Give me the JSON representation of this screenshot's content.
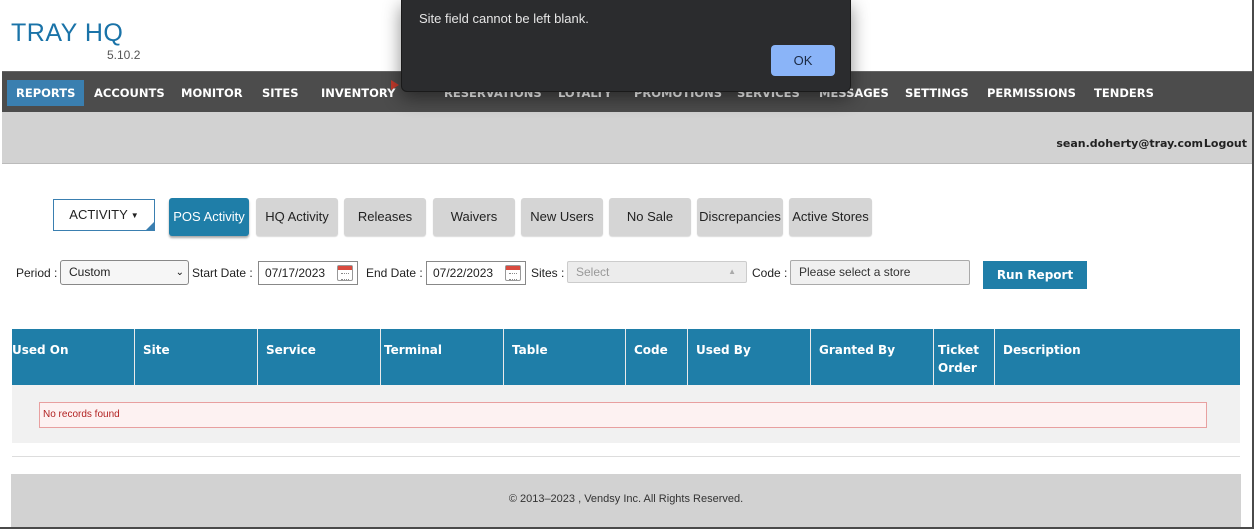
{
  "app": {
    "title": "TRAY HQ",
    "version": "5.10.2"
  },
  "nav": {
    "items": [
      {
        "label": "REPORTS",
        "active": true
      },
      {
        "label": "ACCOUNTS"
      },
      {
        "label": "MONITOR"
      },
      {
        "label": "SITES"
      },
      {
        "label": "INVENTORY"
      },
      {
        "label": "RESERVATIONS"
      },
      {
        "label": "LOYALTY"
      },
      {
        "label": "PROMOTIONS"
      },
      {
        "label": "SERVICES"
      },
      {
        "label": "MESSAGES"
      },
      {
        "label": "SETTINGS"
      },
      {
        "label": "PERMISSIONS"
      },
      {
        "label": "TENDERS"
      }
    ]
  },
  "user": {
    "email": "sean.doherty@tray.com",
    "logout": "Logout"
  },
  "reports": {
    "category_dropdown": "ACTIVITY",
    "tabs": [
      {
        "label": "POS Activity",
        "active": true
      },
      {
        "label": "HQ Activity"
      },
      {
        "label": "Releases"
      },
      {
        "label": "Waivers"
      },
      {
        "label": "New Users"
      },
      {
        "label": "No Sale"
      },
      {
        "label": "Discrepancies"
      },
      {
        "label": "Active Stores"
      }
    ]
  },
  "filters": {
    "period_label": "Period :",
    "period_value": "Custom",
    "start_label": "Start Date :",
    "start_value": "07/17/2023",
    "end_label": "End Date :",
    "end_value": "07/22/2023",
    "sites_label": "Sites :",
    "sites_placeholder": "Select",
    "code_label": "Code :",
    "code_value": "Please select a store",
    "run_button": "Run Report"
  },
  "table": {
    "columns": [
      "Used On",
      "Site",
      "Service",
      "Terminal",
      "Table",
      "Code",
      "Used By",
      "Granted By",
      "Ticket Order",
      "Description"
    ],
    "empty_message": "No records found"
  },
  "footer": {
    "text": "© 2013–2023 , Vendsy Inc. All Rights Reserved."
  },
  "dialog": {
    "message": "Site field cannot be left blank.",
    "ok_label": "OK"
  },
  "colors": {
    "brand": "#1a73a8",
    "header_blue": "#1f7ea8",
    "nav_bg": "#4c4c4c",
    "error": "#b22222"
  }
}
